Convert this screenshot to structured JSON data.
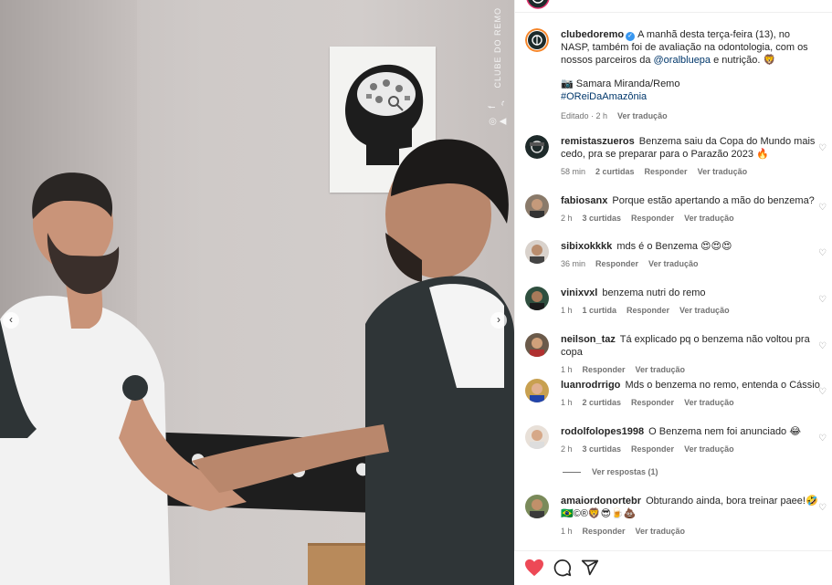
{
  "photo": {
    "watermark_text": "CLUBE DO REMO",
    "watermark_icons": "◎ f ▶ ♪",
    "prev_icon": "‹",
    "next_icon": "›"
  },
  "caption": {
    "username": "clubedoremo",
    "verified": "✓",
    "text_before": "A manhã desta terça-feira (13), no NASP, também foi de avaliação na odontologia, com os nossos parceiros da ",
    "mention": "@oralbluepa",
    "text_after": " e nutrição. 🦁",
    "credit": "📷 Samara Miranda/Remo",
    "hashtag": "#OReiDaAmazônia",
    "edited": "Editado · 2 h",
    "see_translation": "Ver tradução"
  },
  "comments": [
    {
      "username": "remistaszueros",
      "text": "Benzema saiu da Copa do Mundo mais cedo, pra se preparar para o Parazão 2023 🔥",
      "time": "58 min",
      "likes": "2 curtidas",
      "reply": "Responder",
      "translate": "Ver tradução"
    },
    {
      "username": "fabiosanx",
      "text": "Porque estão apertando a mão do benzema?",
      "time": "2 h",
      "likes": "3 curtidas",
      "reply": "Responder",
      "translate": "Ver tradução"
    },
    {
      "username": "sibixokkkk",
      "text": "mds é o Benzema 😍😍😍",
      "time": "36 min",
      "likes": "",
      "reply": "Responder",
      "translate": "Ver tradução"
    },
    {
      "username": "vinixvxl",
      "text": "benzema nutri do remo",
      "time": "1 h",
      "likes": "1 curtida",
      "reply": "Responder",
      "translate": "Ver tradução"
    },
    {
      "username": "neilson_taz",
      "text": "Tá explicado pq o benzema não voltou pra copa",
      "time": "1 h",
      "likes": "",
      "reply": "Responder",
      "translate": "Ver tradução"
    },
    {
      "username": "luanrodrrigo",
      "text": "Mds o benzema no remo, entenda o Cássio",
      "time": "1 h",
      "likes": "2 curtidas",
      "reply": "Responder",
      "translate": "Ver tradução"
    },
    {
      "username": "rodolfolopes1998",
      "text": "O Benzema nem foi anunciado 😂",
      "time": "2 h",
      "likes": "3 curtidas",
      "reply": "Responder",
      "translate": "Ver tradução"
    },
    {
      "username": "amaiordonortebr",
      "text": "Obturando ainda, bora treinar paee!🤣🇧🇷©®🦁😎🍺💩",
      "time": "1 h",
      "likes": "",
      "reply": "Responder",
      "translate": "Ver tradução"
    }
  ],
  "view_replies": "Ver respostas (1)",
  "like_icon": "♡",
  "colors": {
    "liked": "#ed4956",
    "link": "#00376b",
    "verified": "#3897f0"
  }
}
